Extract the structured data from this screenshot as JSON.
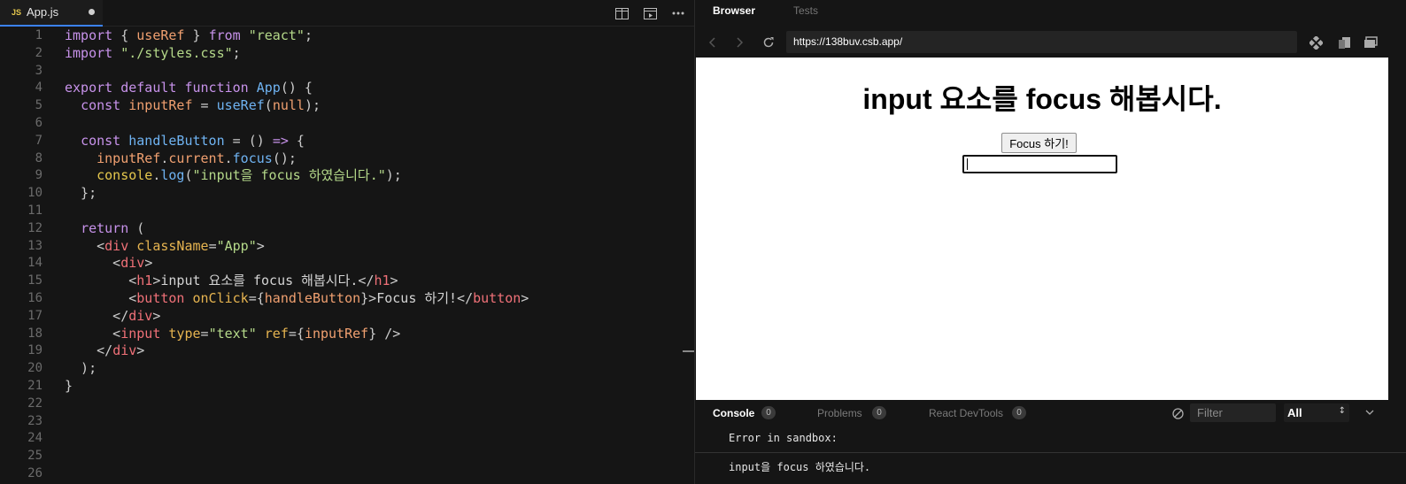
{
  "editor": {
    "tab": {
      "badge": "JS",
      "filename": "App.js"
    },
    "lines": [
      {
        "n": "1"
      },
      {
        "n": "2"
      },
      {
        "n": "3"
      },
      {
        "n": "4"
      },
      {
        "n": "5"
      },
      {
        "n": "6"
      },
      {
        "n": "7"
      },
      {
        "n": "8"
      },
      {
        "n": "9"
      },
      {
        "n": "10"
      },
      {
        "n": "11"
      },
      {
        "n": "12"
      },
      {
        "n": "13"
      },
      {
        "n": "14"
      },
      {
        "n": "15"
      },
      {
        "n": "16"
      },
      {
        "n": "17"
      },
      {
        "n": "18"
      },
      {
        "n": "19"
      },
      {
        "n": "20"
      },
      {
        "n": "21"
      },
      {
        "n": "22"
      },
      {
        "n": "23"
      },
      {
        "n": "24"
      },
      {
        "n": "25"
      },
      {
        "n": "26"
      }
    ],
    "code": [
      [
        "import",
        " { ",
        "useRef",
        " } ",
        "from",
        " ",
        "\"react\"",
        ";"
      ],
      [
        "import",
        " ",
        "\"./styles.css\"",
        ";"
      ],
      [],
      [
        "export",
        " ",
        "default",
        " ",
        "function",
        " ",
        "App",
        "() {"
      ],
      [
        "  ",
        "const",
        " ",
        "inputRef",
        " = ",
        "useRef",
        "(",
        "null",
        ");"
      ],
      [],
      [
        "  ",
        "const",
        " ",
        "handleButton",
        " = () ",
        "=>",
        " {"
      ],
      [
        "    ",
        "inputRef",
        ".",
        "current",
        ".",
        "focus",
        "();"
      ],
      [
        "    ",
        "console",
        ".",
        "log",
        "(",
        "\"input을 focus 하였습니다.\"",
        ");"
      ],
      [
        "  };"
      ],
      [],
      [
        "  ",
        "return",
        " ("
      ],
      [
        "    <",
        "div",
        " ",
        "className",
        "=",
        "\"App\"",
        ">"
      ],
      [
        "      <",
        "div",
        ">"
      ],
      [
        "        <",
        "h1",
        ">",
        "input 요소를 focus 해봅시다.",
        "</",
        "h1",
        ">"
      ],
      [
        "        <",
        "button",
        " ",
        "onClick",
        "={",
        "handleButton",
        "}>",
        "Focus 하기!",
        "</",
        "button",
        ">"
      ],
      [
        "      </",
        "div",
        ">"
      ],
      [
        "      <",
        "input",
        " ",
        "type",
        "=",
        "\"text\"",
        " ",
        "ref",
        "={",
        "inputRef",
        "} />"
      ],
      [
        "    </",
        "div",
        ">"
      ],
      [
        "  );"
      ],
      [
        "}"
      ],
      [],
      [],
      [],
      [],
      []
    ],
    "classes": [
      [
        "kw",
        "punc",
        "var",
        "punc",
        "kw",
        "punc",
        "str",
        "punc"
      ],
      [
        "kw",
        "punc",
        "str",
        "punc"
      ],
      [],
      [
        "kw",
        "punc",
        "kw",
        "punc",
        "kw",
        "punc",
        "fn",
        "punc"
      ],
      [
        "punc",
        "kw",
        "punc",
        "var",
        "punc",
        "fn",
        "punc",
        "var",
        "punc"
      ],
      [],
      [
        "punc",
        "kw",
        "punc",
        "fn",
        "punc",
        "kw",
        "punc"
      ],
      [
        "punc",
        "var",
        "punc",
        "var",
        "punc",
        "mth",
        "punc"
      ],
      [
        "punc",
        "cons",
        "punc",
        "mth",
        "punc",
        "str",
        "punc"
      ],
      [
        "punc"
      ],
      [],
      [
        "punc",
        "kw",
        "punc"
      ],
      [
        "punc",
        "tag",
        "punc",
        "attr",
        "punc",
        "str",
        "punc"
      ],
      [
        "punc",
        "tag",
        "punc"
      ],
      [
        "punc",
        "tag",
        "punc",
        "txt",
        "punc",
        "tag",
        "punc"
      ],
      [
        "punc",
        "tag",
        "punc",
        "attr",
        "punc",
        "var",
        "punc",
        "txt",
        "punc",
        "tag",
        "punc"
      ],
      [
        "punc",
        "tag",
        "punc"
      ],
      [
        "punc",
        "tag",
        "punc",
        "attr",
        "punc",
        "str",
        "punc",
        "attr",
        "punc",
        "var",
        "punc"
      ],
      [
        "punc",
        "tag",
        "punc"
      ],
      [
        "punc"
      ],
      [
        "punc"
      ],
      [],
      [],
      [],
      [],
      []
    ]
  },
  "preview": {
    "tabs": {
      "browser": "Browser",
      "tests": "Tests"
    },
    "url": "https://138buv.csb.app/",
    "page": {
      "heading": "input 요소를 focus 해봅시다.",
      "button": "Focus 하기!"
    },
    "console": {
      "tabs": [
        {
          "label": "Console",
          "count": "0"
        },
        {
          "label": "Problems",
          "count": "0"
        },
        {
          "label": "React DevTools",
          "count": "0"
        }
      ],
      "filter_placeholder": "Filter",
      "level": "All",
      "messages": [
        "Error in sandbox:",
        "input을 focus 하였습니다."
      ]
    }
  },
  "colors": {
    "accent": "#3b82f6",
    "background": "#151515"
  }
}
